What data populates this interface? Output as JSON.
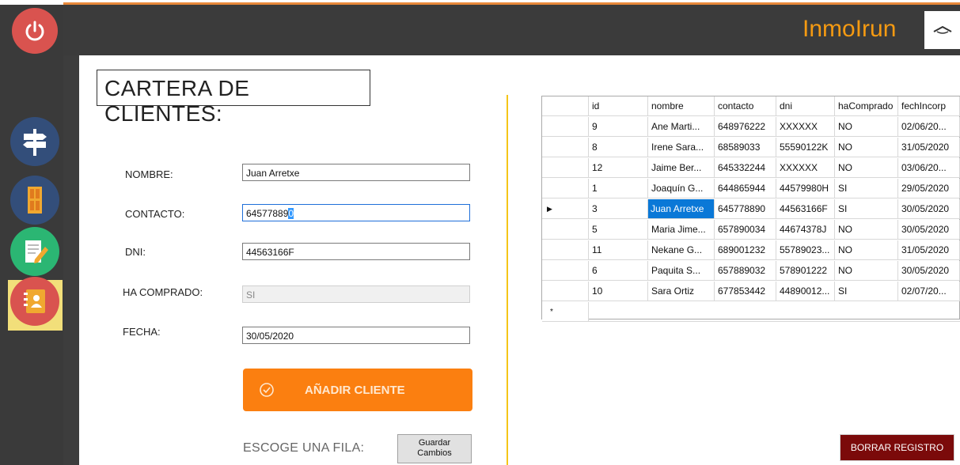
{
  "app": {
    "brand": "InmoIrun"
  },
  "sidebar": {
    "items": [
      {
        "icon": "power-icon",
        "color": "#d9534f"
      },
      {
        "icon": "signpost-icon",
        "color": "#334e7a"
      },
      {
        "icon": "door-icon",
        "color": "#334e7a"
      },
      {
        "icon": "edit-icon",
        "color": "#2bb673"
      },
      {
        "icon": "contacts-book-icon",
        "color": "#d9534f"
      }
    ]
  },
  "form": {
    "title": "CARTERA DE CLIENTES:",
    "nombre_label": "NOMBRE:",
    "nombre_value": "Juan Arretxe",
    "contacto_label": "CONTACTO:",
    "contacto_value_main": "64577889",
    "contacto_value_sel": "0",
    "dni_label": "DNI:",
    "dni_value": "44563166F",
    "comprado_label": "HA COMPRADO:",
    "comprado_value": "SI",
    "fecha_label": "FECHA:",
    "fecha_value": "30/05/2020",
    "add_button": "AÑADIR CLIENTE",
    "choose_label": "ESCOGE UNA FILA:",
    "save_button_line1": "Guardar",
    "save_button_line2": "Cambios"
  },
  "table": {
    "columns": [
      "id",
      "nombre",
      "contacto",
      "dni",
      "haComprado",
      "fechIncorp"
    ],
    "rows": [
      [
        "9",
        "Ane Marti...",
        "648976222",
        "XXXXXX",
        "NO",
        "02/06/20..."
      ],
      [
        "8",
        "Irene Sara...",
        "68589033",
        "55590122K",
        "NO",
        "31/05/2020"
      ],
      [
        "12",
        "Jaime Ber...",
        "645332244",
        "XXXXXX",
        "NO",
        "03/06/20..."
      ],
      [
        "1",
        "Joaquín G...",
        "644865944",
        "44579980H",
        "SI",
        "29/05/2020"
      ],
      [
        "3",
        "Juan Arretxe",
        "645778890",
        "44563166F",
        "SI",
        "30/05/2020"
      ],
      [
        "5",
        "Maria Jime...",
        "657890034",
        "44674378J",
        "NO",
        "30/05/2020"
      ],
      [
        "11",
        "Nekane G...",
        "689001232",
        "55789023...",
        "NO",
        "31/05/2020"
      ],
      [
        "6",
        "Paquita S...",
        "657889032",
        "578901222",
        "NO",
        "30/05/2020"
      ],
      [
        "10",
        "Sara Ortiz",
        "677853442",
        "44890012...",
        "SI",
        "02/07/20..."
      ]
    ],
    "current_row_marker": "▶",
    "new_row_marker": "*",
    "selected_row_index": 4
  },
  "delete_button": "BORRAR REGISTRO",
  "colors": {
    "accent": "#fb7f10",
    "brand": "#f59a12",
    "danger": "#7b0a0a",
    "divider": "#f5c518"
  }
}
